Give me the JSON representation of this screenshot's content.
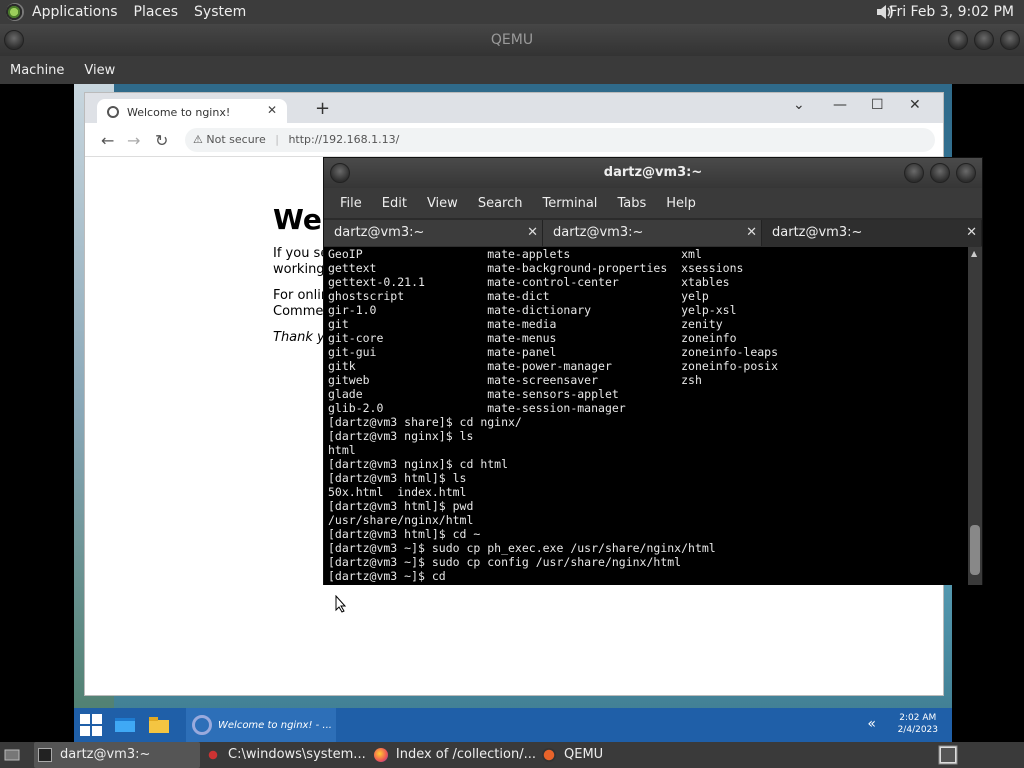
{
  "top_panel": {
    "menus": [
      "Applications",
      "Places",
      "System"
    ],
    "clock": "Fri Feb  3, 9:02 PM"
  },
  "qemu": {
    "title": "QEMU",
    "menus": [
      "Machine",
      "View"
    ]
  },
  "browser": {
    "tab_title": "Welcome to nginx!",
    "new_tab": "+",
    "address_security": "Not secure",
    "address_url": "http://192.168.1.13/",
    "page_heading": "Wel",
    "page_p1_line1": "If you se",
    "page_p1_line2": "working.",
    "page_p2_line1": "For onlin",
    "page_p2_line2": "Commer",
    "page_p3": "Thank y"
  },
  "terminal": {
    "title": "dartz@vm3:~",
    "menus": [
      "File",
      "Edit",
      "View",
      "Search",
      "Terminal",
      "Tabs",
      "Help"
    ],
    "tabs": [
      "dartz@vm3:~",
      "dartz@vm3:~",
      "dartz@vm3:~"
    ],
    "lines": [
      "GeoIP                  mate-applets                xml",
      "gettext                mate-background-properties  xsessions",
      "gettext-0.21.1         mate-control-center         xtables",
      "ghostscript            mate-dict                   yelp",
      "gir-1.0                mate-dictionary             yelp-xsl",
      "git                    mate-media                  zenity",
      "git-core               mate-menus                  zoneinfo",
      "git-gui                mate-panel                  zoneinfo-leaps",
      "gitk                   mate-power-manager          zoneinfo-posix",
      "gitweb                 mate-screensaver            zsh",
      "glade                  mate-sensors-applet",
      "glib-2.0               mate-session-manager",
      "[dartz@vm3 share]$ cd nginx/",
      "[dartz@vm3 nginx]$ ls",
      "html",
      "[dartz@vm3 nginx]$ cd html",
      "[dartz@vm3 html]$ ls",
      "50x.html  index.html",
      "[dartz@vm3 html]$ pwd",
      "/usr/share/nginx/html",
      "[dartz@vm3 html]$ cd ~",
      "[dartz@vm3 ~]$ sudo cp ph_exec.exe /usr/share/nginx/html",
      "[dartz@vm3 ~]$ sudo cp config /usr/share/nginx/html",
      "[dartz@vm3 ~]$ cd"
    ]
  },
  "win_taskbar": {
    "chrome_item": "Welcome to nginx! - ...",
    "time": "2:02 AM",
    "date": "2/4/2023"
  },
  "bottom_panel": {
    "items": [
      "dartz@vm3:~",
      "C:\\windows\\system...",
      "Index of /collection/...",
      "QEMU"
    ]
  }
}
